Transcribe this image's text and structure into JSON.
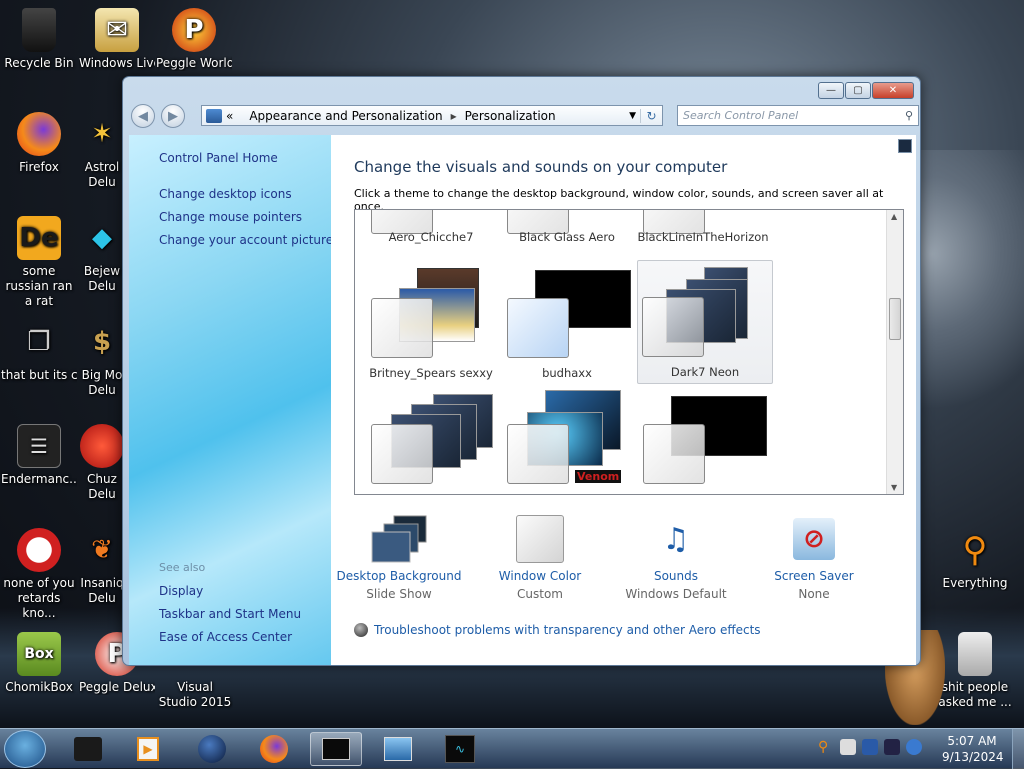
{
  "desktop": {
    "icons": [
      {
        "label": "Recycle Bin",
        "icon": "recycle-bin-icon",
        "color": "#1a1a1a"
      },
      {
        "label": "Windows Live Ma",
        "icon": "mail-icon",
        "color": "#d9b44a"
      },
      {
        "label": "Peggle World",
        "icon": "peggle-icon",
        "color": "#d32c1a"
      },
      {
        "label": "Firefox",
        "icon": "firefox-icon",
        "color": "#e86a1c"
      },
      {
        "label": "Astrol Delu",
        "icon": "astro-icon",
        "color": "#e03a2a"
      },
      {
        "label": "some russian ran a rat",
        "icon": "de-icon",
        "color": "#f2a81e"
      },
      {
        "label": "Bejew Delu",
        "icon": "gem-icon",
        "color": "#2cc4e8"
      },
      {
        "label": "that but its c#",
        "icon": "windows-stack-icon",
        "color": "#888888"
      },
      {
        "label": "Big Mo Delu",
        "icon": "money-icon",
        "color": "#8a5a2a"
      },
      {
        "label": "Endermanc...",
        "icon": "list-icon",
        "color": "#222222"
      },
      {
        "label": "Chuz Delu",
        "icon": "chuzzle-icon",
        "color": "#cc2020"
      },
      {
        "label": "none of you retards kno...",
        "icon": "dragon-icon",
        "color": "#c82020"
      },
      {
        "label": "Insaniq Delu",
        "icon": "fish-icon",
        "color": "#e86020"
      },
      {
        "label": "ChomikBox",
        "icon": "hamster-icon",
        "color": "#6aa820"
      },
      {
        "label": "Peggle Deluxe",
        "icon": "peggle-icon",
        "color": "#d32c1a"
      },
      {
        "label": "Visual Studio 2015",
        "icon": "vs-icon",
        "color": "#6a3aa8"
      },
      {
        "label": "Everything",
        "icon": "magnifier-icon",
        "color": "#f08a10"
      },
      {
        "label": "shit people asked me ...",
        "icon": "folder-icon",
        "color": "#cccccc"
      }
    ]
  },
  "window": {
    "address": [
      "Appearance and Personalization",
      "Personalization"
    ],
    "search_placeholder": "Search Control Panel",
    "sidebar": {
      "home": "Control Panel Home",
      "links": [
        "Change desktop icons",
        "Change mouse pointers",
        "Change your account picture"
      ],
      "see_also": "See also",
      "see_also_links": [
        "Display",
        "Taskbar and Start Menu",
        "Ease of Access Center"
      ]
    },
    "heading": "Change the visuals and sounds on your computer",
    "subheading": "Click a theme to change the desktop background, window color, sounds, and screen saver all at once.",
    "themes_top": [
      "Aero_Chicche7",
      "Black Glass Aero",
      "BlackLineInTheHorizon"
    ],
    "themes_mid": [
      "Britney_Spears sexxy",
      "budhaxx",
      "Dark7 Neon"
    ],
    "selected_theme": "Dark7 Neon",
    "bottom_overlay_text": "Venom",
    "options": [
      {
        "name": "Desktop Background",
        "value": "Slide Show",
        "icon": "desktop-background-icon"
      },
      {
        "name": "Window Color",
        "value": "Custom",
        "icon": "window-color-icon"
      },
      {
        "name": "Sounds",
        "value": "Windows Default",
        "icon": "sounds-icon"
      },
      {
        "name": "Screen Saver",
        "value": "None",
        "icon": "screen-saver-icon"
      }
    ],
    "troubleshoot": "Troubleshoot problems with transparency and other Aero effects"
  },
  "taskbar": {
    "time": "5:07 AM",
    "date": "9/13/2024"
  }
}
